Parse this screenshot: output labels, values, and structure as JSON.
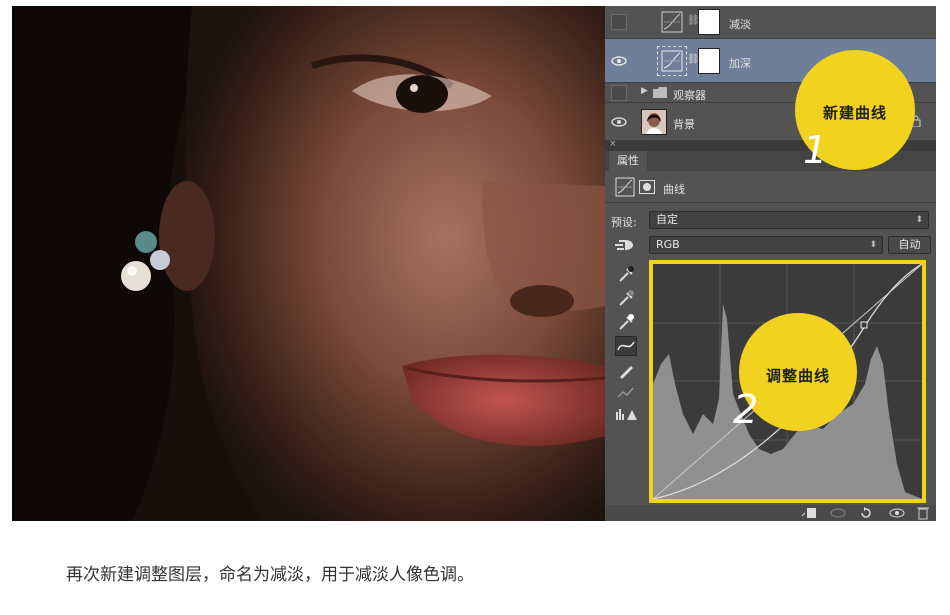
{
  "layers": [
    {
      "name": "减淡",
      "type": "curves",
      "visible": false,
      "selected": false
    },
    {
      "name": "加深",
      "type": "curves",
      "visible": true,
      "selected": true
    },
    {
      "name": "观察器",
      "type": "group",
      "visible": false,
      "selected": false
    },
    {
      "name": "背景",
      "type": "image",
      "visible": true,
      "locked": true,
      "selected": false
    }
  ],
  "properties": {
    "tab": "属性",
    "adjustment_name": "曲线",
    "preset_label": "预设:",
    "preset_value": "自定",
    "channel_value": "RGB",
    "auto_button": "自动"
  },
  "annotations": {
    "step1_text": "新建曲线",
    "step1_number": "1",
    "step2_text": "调整曲线",
    "step2_number": "2",
    "highlight_color": "#f1d21f"
  },
  "caption": "再次新建调整图层，命名为减淡，用于减淡人像色调。"
}
